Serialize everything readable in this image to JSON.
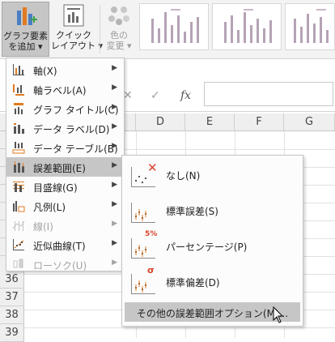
{
  "ribbon": {
    "add_chart_element": {
      "line1": "グラフ要素",
      "line2": "を追加 ▾"
    },
    "quick_layout": {
      "line1": "クイック",
      "line2": "レイアウト ▾"
    },
    "change_colors": {
      "line1": "色の",
      "line2": "変更 ▾"
    }
  },
  "columns": [
    "D",
    "E",
    "F",
    "G"
  ],
  "rows": [
    "36",
    "37",
    "38",
    "39",
    "40"
  ],
  "formula_bar": {
    "cancel": "✕",
    "enter": "✓",
    "fx": "fx"
  },
  "menu": {
    "items": [
      {
        "label": "軸(X)",
        "icon": "axes-icon",
        "has_submenu": true,
        "enabled": true
      },
      {
        "label": "軸ラベル(A)",
        "icon": "axis-titles-icon",
        "has_submenu": true,
        "enabled": true
      },
      {
        "label": "グラフ タイトル(C)",
        "icon": "chart-title-icon",
        "has_submenu": true,
        "enabled": true
      },
      {
        "label": "データ ラベル(D)",
        "icon": "data-labels-icon",
        "has_submenu": true,
        "enabled": true
      },
      {
        "label": "データ テーブル(B)",
        "icon": "data-table-icon",
        "has_submenu": true,
        "enabled": true
      },
      {
        "label": "誤差範囲(E)",
        "icon": "error-bars-icon",
        "has_submenu": true,
        "enabled": true,
        "highlighted": true
      },
      {
        "label": "目盛線(G)",
        "icon": "gridlines-icon",
        "has_submenu": true,
        "enabled": true
      },
      {
        "label": "凡例(L)",
        "icon": "legend-icon",
        "has_submenu": true,
        "enabled": true
      },
      {
        "label": "線(I)",
        "icon": "lines-icon",
        "has_submenu": true,
        "enabled": false
      },
      {
        "label": "近似曲線(T)",
        "icon": "trendline-icon",
        "has_submenu": true,
        "enabled": true
      },
      {
        "label": "ローソク(U)",
        "icon": "up-down-bars-icon",
        "has_submenu": true,
        "enabled": false
      }
    ]
  },
  "submenu": {
    "items": [
      {
        "label": "なし(N)",
        "icon": "error-bars-none-icon",
        "badge": "✕"
      },
      {
        "label": "標準誤差(S)",
        "icon": "standard-error-icon",
        "badge": ""
      },
      {
        "label": "パーセンテージ(P)",
        "icon": "percentage-error-icon",
        "badge": "5%"
      },
      {
        "label": "標準偏差(D)",
        "icon": "standard-deviation-icon",
        "badge": "σ"
      }
    ],
    "more_options": "その他の誤差範囲オプション(M)..."
  },
  "colors": {
    "highlight": "#c6c6c6",
    "accent_red": "#d9442b",
    "icon_orange": "#e07b22",
    "icon_blue": "#4a7ec0"
  }
}
